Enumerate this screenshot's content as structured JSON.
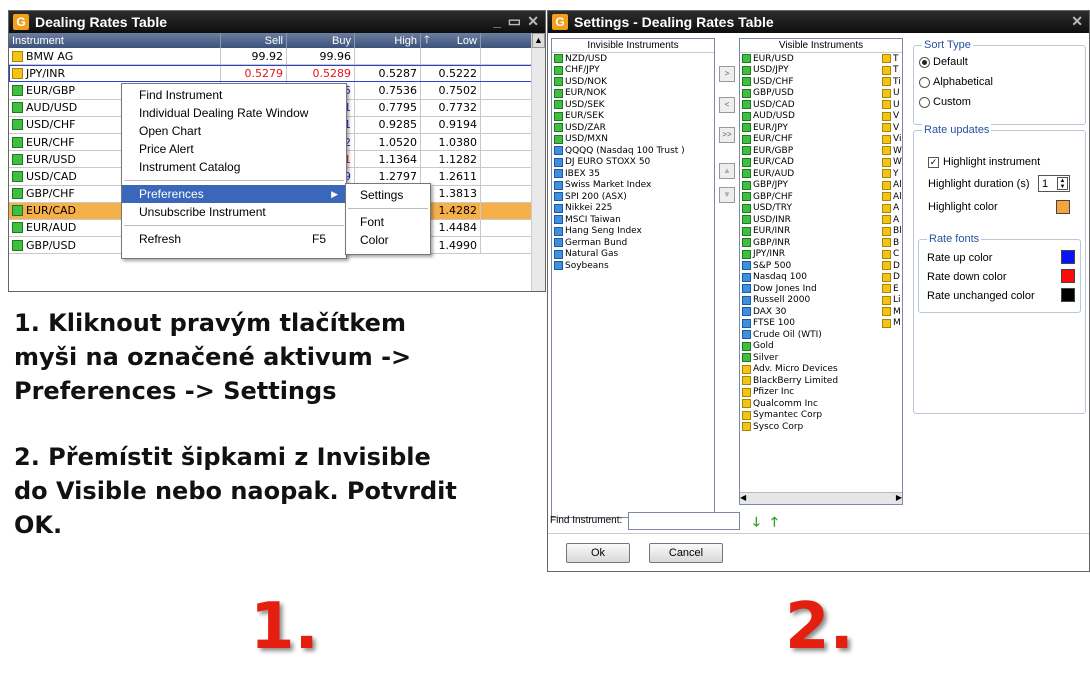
{
  "rates_window": {
    "title": "Dealing Rates Table",
    "columns": [
      "Instrument",
      "Sell",
      "Buy",
      "High",
      "Low"
    ],
    "rows": [
      {
        "icon": "y",
        "instrument": "BMW AG",
        "sell": "99.92",
        "buy": "99.96",
        "high": "",
        "low": ""
      },
      {
        "icon": "y",
        "instrument": "JPY/INR",
        "sell": "0.5279",
        "buy": "0.5289",
        "high": "0.5287",
        "low": "0.5222"
      },
      {
        "icon": "g",
        "instrument": "EUR/GBP",
        "sell": "",
        "buy": ".7515",
        "high": "0.7536",
        "low": "0.7502"
      },
      {
        "icon": "g",
        "instrument": "AUD/USD",
        "sell": "",
        "buy": ".7761",
        "high": "0.7795",
        "low": "0.7732"
      },
      {
        "icon": "g",
        "instrument": "USD/CHF",
        "sell": "",
        "buy": ".9211",
        "high": "0.9285",
        "low": "0.9194"
      },
      {
        "icon": "g",
        "instrument": "EUR/CHF",
        "sell": "",
        "buy": ".0402",
        "high": "1.0520",
        "low": "1.0380"
      },
      {
        "icon": "g",
        "instrument": "EUR/USD",
        "sell": "",
        "buy": ".1291",
        "high": "1.1364",
        "low": "1.1282"
      },
      {
        "icon": "g",
        "instrument": "USD/CAD",
        "sell": "",
        "buy": ".2719",
        "high": "1.2797",
        "low": "1.2611"
      },
      {
        "icon": "g",
        "instrument": "GBP/CHF",
        "sell": "",
        "buy": "",
        "high": "988",
        "low": "1.3813"
      },
      {
        "icon": "g",
        "instrument": "EUR/CAD",
        "sell": "",
        "buy": "",
        "high": "487",
        "low": "1.4282"
      },
      {
        "icon": "g",
        "instrument": "EUR/AUD",
        "sell": "",
        "buy": "",
        "high": "669",
        "low": "1.4484"
      },
      {
        "icon": "g",
        "instrument": "GBP/USD",
        "sell": "",
        "buy": "",
        "high": "5093",
        "low": "1.4990"
      }
    ],
    "colors": {
      "up": "#1c2bd8",
      "down": "#e8141e",
      "selected_row": "#f6b04a"
    }
  },
  "context_menu": {
    "items": [
      "Find Instrument",
      "Individual Dealing Rate Window",
      "Open Chart",
      "Price Alert",
      "Instrument Catalog"
    ],
    "preferences": "Preferences",
    "unsubscribe": "Unsubscribe Instrument",
    "refresh": "Refresh",
    "refresh_shortcut": "F5",
    "submenu": [
      "Settings",
      "Font",
      "Color"
    ]
  },
  "instructions": {
    "step1": [
      "1. Kliknout pravým tlačítkem",
      "myši na označené aktivum ->",
      "Preferences -> Settings"
    ],
    "step2": [
      "2. Přemístit šipkami z Invisible",
      "do Visible nebo naopak. Potvrdit",
      "OK."
    ],
    "num1": "1.",
    "num2": "2."
  },
  "settings_window": {
    "title": "Settings - Dealing Rates Table",
    "invisible_header": "Invisible Instruments",
    "invisible": [
      {
        "i": "g",
        "t": "NZD/USD"
      },
      {
        "i": "g",
        "t": "CHF/JPY"
      },
      {
        "i": "g",
        "t": "USD/NOK"
      },
      {
        "i": "g",
        "t": "EUR/NOK"
      },
      {
        "i": "g",
        "t": "USD/SEK"
      },
      {
        "i": "g",
        "t": "EUR/SEK"
      },
      {
        "i": "g",
        "t": "USD/ZAR"
      },
      {
        "i": "g",
        "t": "USD/MXN"
      },
      {
        "i": "b",
        "t": "QQQQ (Nasdaq 100 Trust )"
      },
      {
        "i": "b",
        "t": "DJ EURO STOXX 50"
      },
      {
        "i": "b",
        "t": "IBEX 35"
      },
      {
        "i": "b",
        "t": "Swiss Market Index"
      },
      {
        "i": "b",
        "t": "SPI 200 (ASX)"
      },
      {
        "i": "b",
        "t": "Nikkei 225"
      },
      {
        "i": "b",
        "t": "MSCI Taiwan"
      },
      {
        "i": "b",
        "t": "Hang Seng Index"
      },
      {
        "i": "b",
        "t": "German Bund"
      },
      {
        "i": "b",
        "t": "Natural Gas"
      },
      {
        "i": "b",
        "t": "Soybeans"
      }
    ],
    "visible_header": "Visible Instruments",
    "visible": [
      {
        "i": "g",
        "t": "EUR/USD"
      },
      {
        "i": "g",
        "t": "USD/JPY"
      },
      {
        "i": "g",
        "t": "USD/CHF"
      },
      {
        "i": "g",
        "t": "GBP/USD"
      },
      {
        "i": "g",
        "t": "USD/CAD"
      },
      {
        "i": "g",
        "t": "AUD/USD"
      },
      {
        "i": "g",
        "t": "EUR/JPY"
      },
      {
        "i": "g",
        "t": "EUR/CHF"
      },
      {
        "i": "g",
        "t": "EUR/GBP"
      },
      {
        "i": "g",
        "t": "EUR/CAD"
      },
      {
        "i": "g",
        "t": "EUR/AUD"
      },
      {
        "i": "g",
        "t": "GBP/JPY"
      },
      {
        "i": "g",
        "t": "GBP/CHF"
      },
      {
        "i": "g",
        "t": "USD/TRY"
      },
      {
        "i": "g",
        "t": "USD/INR"
      },
      {
        "i": "g",
        "t": "EUR/INR"
      },
      {
        "i": "g",
        "t": "GBP/INR"
      },
      {
        "i": "g",
        "t": "JPY/INR"
      },
      {
        "i": "b",
        "t": "S&P 500"
      },
      {
        "i": "b",
        "t": "Nasdaq 100"
      },
      {
        "i": "b",
        "t": "Dow Jones Ind"
      },
      {
        "i": "b",
        "t": "Russell 2000"
      },
      {
        "i": "b",
        "t": "DAX 30"
      },
      {
        "i": "b",
        "t": "FTSE 100"
      },
      {
        "i": "b",
        "t": "Crude Oil (WTI)"
      },
      {
        "i": "g",
        "t": "Gold"
      },
      {
        "i": "g",
        "t": "Silver"
      },
      {
        "i": "y",
        "t": "Adv. Micro Devices"
      },
      {
        "i": "y",
        "t": "BlackBerry Limited"
      },
      {
        "i": "y",
        "t": "Pfizer Inc"
      },
      {
        "i": "y",
        "t": "Qualcomm Inc"
      },
      {
        "i": "y",
        "t": "Symantec Corp"
      },
      {
        "i": "y",
        "t": "Sysco Corp"
      }
    ],
    "visible_col2": [
      "T",
      "T",
      "Ti",
      "U",
      "U",
      "V",
      "V",
      "Vi",
      "W",
      "W",
      "Y",
      "Al",
      "Al",
      "A",
      "A",
      "Bl",
      "B",
      "C",
      "D",
      "D",
      "E",
      "Li",
      "M",
      "M"
    ],
    "find_label": "Find Instrument:",
    "ok": "Ok",
    "cancel": "Cancel",
    "sort_type": {
      "label": "Sort Type",
      "options": [
        "Default",
        "Alphabetical",
        "Custom"
      ],
      "selected": 0
    },
    "rate_updates": {
      "label": "Rate updates",
      "highlight_instrument": "Highlight instrument",
      "highlight_duration": "Highlight duration (s)",
      "duration_value": "1",
      "highlight_color": "Highlight color",
      "highlight_swatch": "#f4a43c"
    },
    "rate_fonts": {
      "label": "Rate fonts",
      "up": "Rate up color",
      "down": "Rate down color",
      "unchanged": "Rate unchanged color",
      "up_swatch": "#0a12ff",
      "down_swatch": "#ff0a0a",
      "unchanged_swatch": "#000000"
    }
  }
}
